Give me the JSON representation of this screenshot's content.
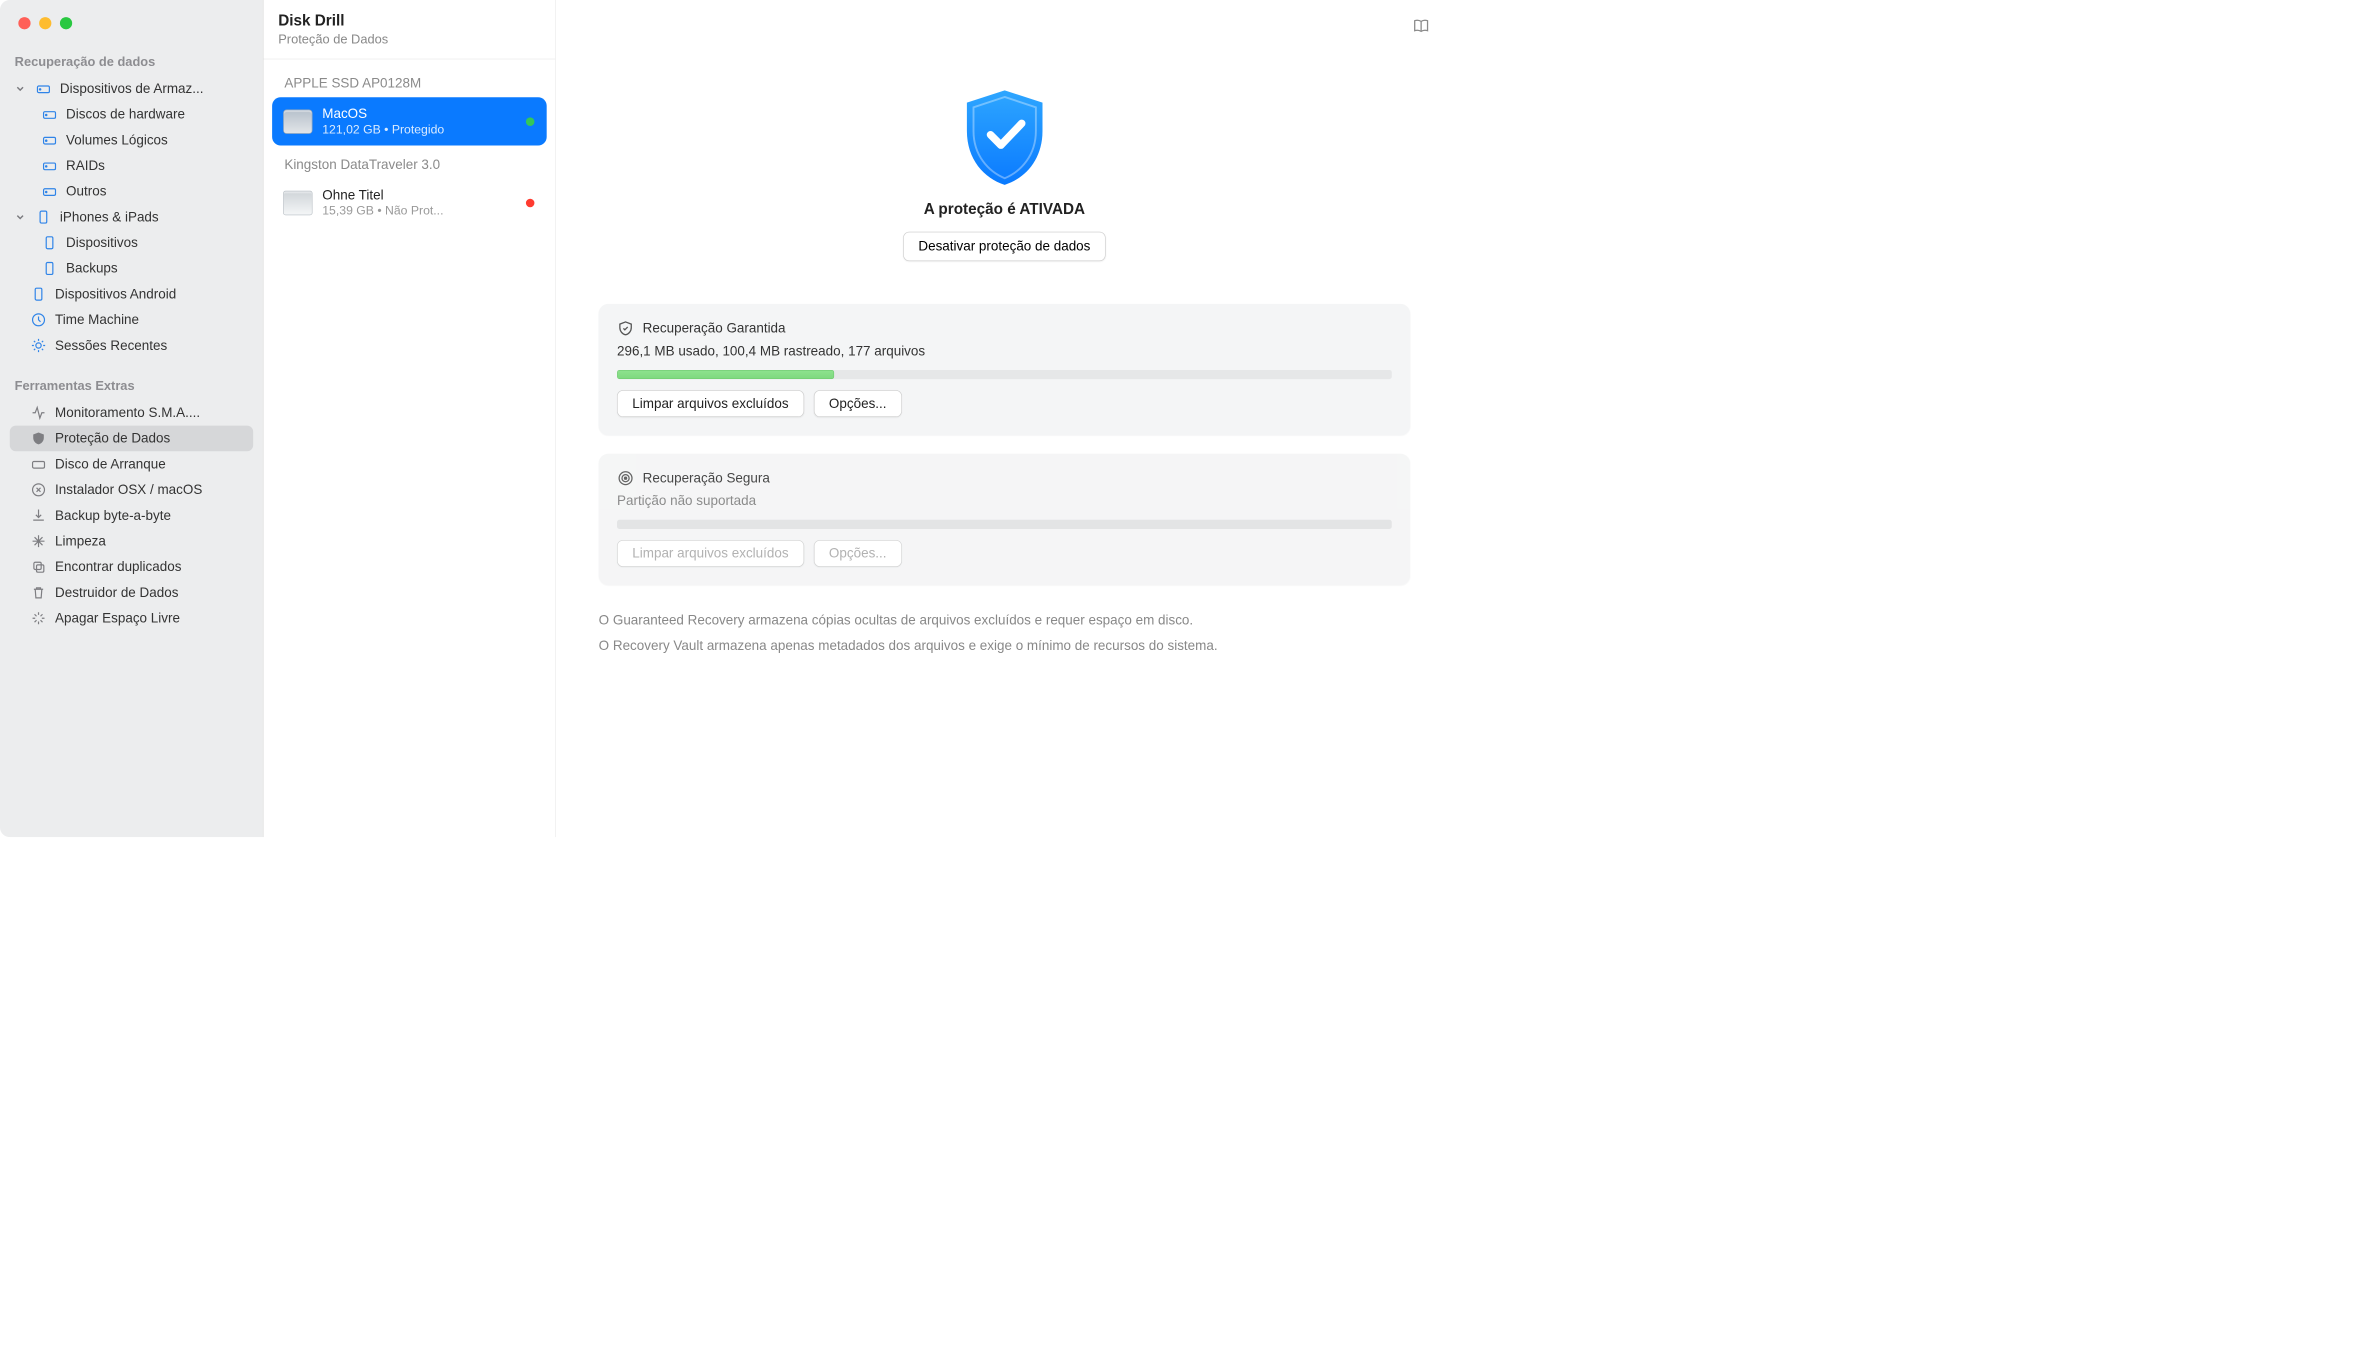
{
  "header": {
    "title": "Disk Drill",
    "subtitle": "Proteção de Dados"
  },
  "sidebar": {
    "section1": {
      "title": "Recuperação de dados",
      "group1": "Dispositivos de Armaz...",
      "items1": [
        "Discos de hardware",
        "Volumes Lógicos",
        "RAIDs",
        "Outros"
      ],
      "group2": "iPhones & iPads",
      "items2": [
        "Dispositivos",
        "Backups"
      ],
      "android": "Dispositivos Android",
      "tm": "Time Machine",
      "recent": "Sessões Recentes"
    },
    "section2": {
      "title": "Ferramentas Extras",
      "items": [
        "Monitoramento S.M.A....",
        "Proteção de Dados",
        "Disco de Arranque",
        "Instalador OSX / macOS",
        "Backup byte-a-byte",
        "Limpeza",
        "Encontrar duplicados",
        "Destruidor de Dados",
        "Apagar Espaço Livre"
      ]
    }
  },
  "volumes": {
    "group1": "APPLE SSD AP0128M",
    "v1": {
      "name": "MacOS",
      "sub": "121,02 GB • Protegido"
    },
    "group2": "Kingston DataTraveler 3.0",
    "v2": {
      "name": "Ohne Titel",
      "sub": "15,39 GB • Não Prot..."
    }
  },
  "main": {
    "hero_title": "A proteção é ATIVADA",
    "hero_btn": "Desativar proteção de dados",
    "panel1": {
      "title": "Recuperação Garantida",
      "sub": "296,1 MB usado, 100,4 MB rastreado, 177 arquivos",
      "progress_pct": 28,
      "btn1": "Limpar arquivos excluídos",
      "btn2": "Opções..."
    },
    "panel2": {
      "title": "Recuperação Segura",
      "sub": "Partição não suportada",
      "btn1": "Limpar arquivos excluídos",
      "btn2": "Opções..."
    },
    "note1": "O Guaranteed Recovery armazena cópias ocultas de arquivos excluídos e requer espaço em disco.",
    "note2": "O Recovery Vault armazena apenas metadados dos arquivos e exige o mínimo de recursos do sistema."
  }
}
